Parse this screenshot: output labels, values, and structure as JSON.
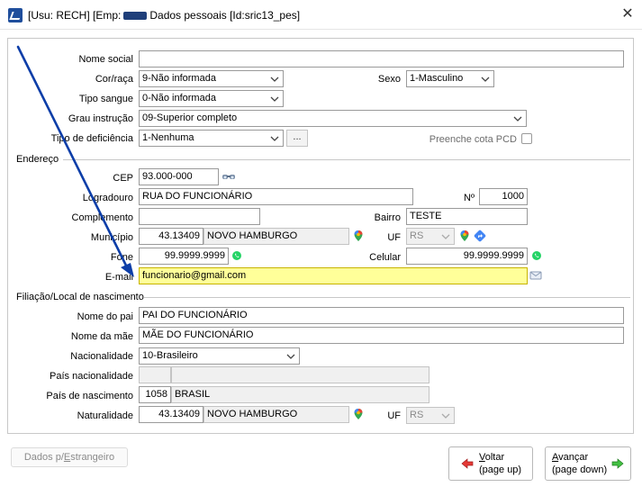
{
  "window": {
    "title_prefix": "[Usu: RECH] [Emp:",
    "title_suffix": "Dados pessoais [Id:sric13_pes]"
  },
  "form": {
    "nome_social": {
      "label": "Nome social",
      "value": ""
    },
    "cor_raca": {
      "label": "Cor/raça",
      "value": "9-Não informada"
    },
    "sexo": {
      "label": "Sexo",
      "value": "1-Masculino"
    },
    "tipo_sangue": {
      "label": "Tipo sangue",
      "value": "0-Não informada"
    },
    "grau_instrucao": {
      "label": "Grau instrução",
      "value": "09-Superior completo"
    },
    "tipo_deficiencia": {
      "label": "Tipo de deficiência",
      "value": "1-Nenhuma",
      "more": "..."
    },
    "cota_pcd": {
      "label": "Preenche cota PCD"
    }
  },
  "endereco": {
    "section": "Endereço",
    "cep": {
      "label": "CEP",
      "value": "93.000-000"
    },
    "logradouro": {
      "label": "Logradouro",
      "value": "RUA DO FUNCIONÁRIO"
    },
    "numero": {
      "label": "Nº",
      "value": "1000"
    },
    "complemento": {
      "label": "Complemento",
      "value": ""
    },
    "bairro": {
      "label": "Bairro",
      "value": "TESTE"
    },
    "municipio": {
      "label": "Município",
      "code": "43.13409",
      "name": "NOVO HAMBURGO"
    },
    "uf": {
      "label": "UF",
      "value": "RS"
    },
    "fone": {
      "label": "Fone",
      "value": "99.9999.9999"
    },
    "celular": {
      "label": "Celular",
      "value": "99.9999.9999"
    },
    "email": {
      "label": "E-mail",
      "value": "funcionario@gmail.com"
    }
  },
  "filiacao": {
    "section": "Filiação/Local de nascimento",
    "nome_pai": {
      "label": "Nome do pai",
      "value": "PAI DO FUNCIONÁRIO"
    },
    "nome_mae": {
      "label": "Nome da mãe",
      "value": "MÃE DO FUNCIONÁRIO"
    },
    "nacionalidade": {
      "label": "Nacionalidade",
      "value": "10-Brasileiro"
    },
    "pais_nacionalidade": {
      "label": "País nacionalidade",
      "code": "",
      "name": ""
    },
    "pais_nascimento": {
      "label": "País de nascimento",
      "code": "1058",
      "name": "BRASIL"
    },
    "naturalidade": {
      "label": "Naturalidade",
      "code": "43.13409",
      "name": "NOVO HAMBURGO"
    },
    "uf": {
      "label": "UF",
      "value": "RS"
    }
  },
  "buttons": {
    "estrangeiro_pre": "Dados p/",
    "estrangeiro_u": "E",
    "estrangeiro_post": "strangeiro",
    "voltar_u": "V",
    "voltar_rest": "oltar",
    "voltar_sub": "(page up)",
    "avancar_u": "A",
    "avancar_rest": "vançar",
    "avancar_sub": "(page down)"
  },
  "colors": {
    "accent": "#1f4e9c",
    "email_highlight": "#ffff99",
    "annotation_arrow": "#0d3ea8"
  }
}
